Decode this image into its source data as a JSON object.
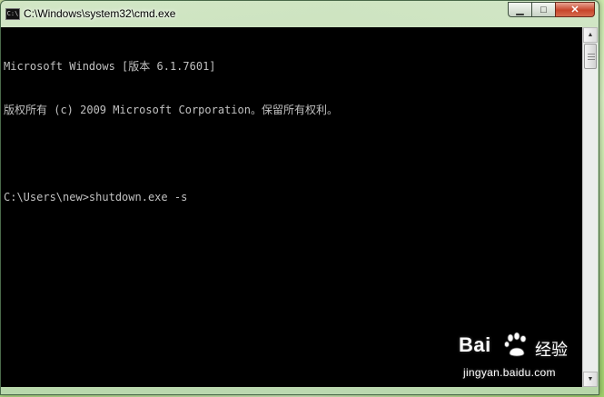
{
  "window": {
    "title": "C:\\Windows\\system32\\cmd.exe",
    "app_icon_text": "C:\\",
    "icon": "cmd-icon"
  },
  "controls": {
    "minimize_glyph": "▁",
    "maximize_glyph": "□",
    "close_glyph": "✕"
  },
  "console": {
    "lines": [
      "Microsoft Windows [版本 6.1.7601]",
      "版权所有 (c) 2009 Microsoft Corporation。保留所有权利。",
      "",
      "C:\\Users\\new>shutdown.exe -s"
    ],
    "text_color": "#c0c0c0",
    "background": "#000000"
  },
  "scrollbar": {
    "up_glyph": "▲",
    "down_glyph": "▼"
  },
  "watermark": {
    "brand_left": "Bai",
    "brand_right": "",
    "product": "经验",
    "url": "jingyan.baidu.com"
  }
}
